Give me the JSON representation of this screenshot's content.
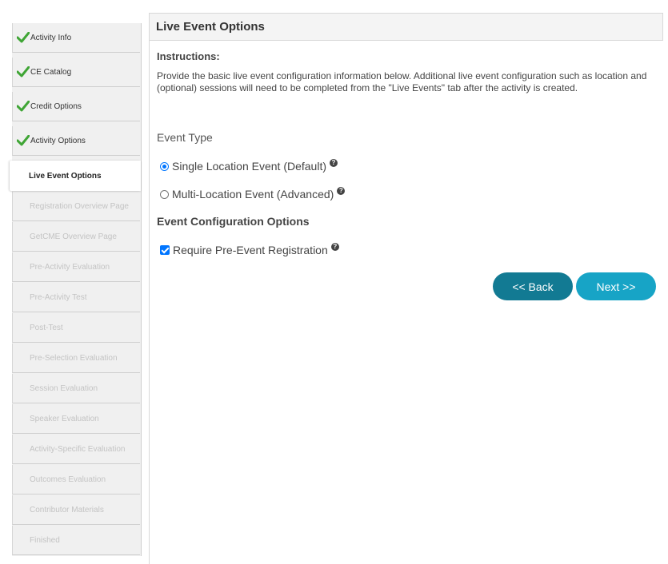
{
  "sidebar": {
    "items": [
      {
        "label": "Activity Info",
        "state": "done"
      },
      {
        "label": "CE Catalog",
        "state": "done"
      },
      {
        "label": "Credit Options",
        "state": "done"
      },
      {
        "label": "Activity Options",
        "state": "done"
      },
      {
        "label": "Live Event Options",
        "state": "active"
      },
      {
        "label": "Registration Overview Page",
        "state": "disabled"
      },
      {
        "label": "GetCME Overview Page",
        "state": "disabled"
      },
      {
        "label": "Pre-Activity Evaluation",
        "state": "disabled"
      },
      {
        "label": "Pre-Activity Test",
        "state": "disabled"
      },
      {
        "label": "Post-Test",
        "state": "disabled"
      },
      {
        "label": "Pre-Selection Evaluation",
        "state": "disabled"
      },
      {
        "label": "Session Evaluation",
        "state": "disabled"
      },
      {
        "label": "Speaker Evaluation",
        "state": "disabled"
      },
      {
        "label": "Activity-Specific Evaluation",
        "state": "disabled"
      },
      {
        "label": "Outcomes Evaluation",
        "state": "disabled"
      },
      {
        "label": "Contributor Materials",
        "state": "disabled"
      },
      {
        "label": "Finished",
        "state": "disabled"
      }
    ]
  },
  "main": {
    "title": "Live Event Options",
    "instructions_title": "Instructions:",
    "instructions_text": "Provide the basic live event configuration information below. Additional live event configuration such as location and (optional) sessions will need to be completed from the \"Live Events\" tab after the activity is created.",
    "event_type_label": "Event Type",
    "event_types": [
      {
        "label": "Single Location Event (Default)",
        "selected": true
      },
      {
        "label": "Multi-Location Event (Advanced)",
        "selected": false
      }
    ],
    "config_title": "Event Configuration Options",
    "require_registration": {
      "label": "Require Pre-Event Registration",
      "checked": true
    },
    "help_icon": "question-circle-icon",
    "check_icon": "green-checkmark-icon"
  },
  "buttons": {
    "back": "<< Back",
    "next": "Next >>"
  },
  "colors": {
    "back_button": "#127a93",
    "next_button": "#17a4c6",
    "check_green": "#3fa535",
    "radio_blue": "#0075ff",
    "disabled_text": "#c3c3c3"
  }
}
